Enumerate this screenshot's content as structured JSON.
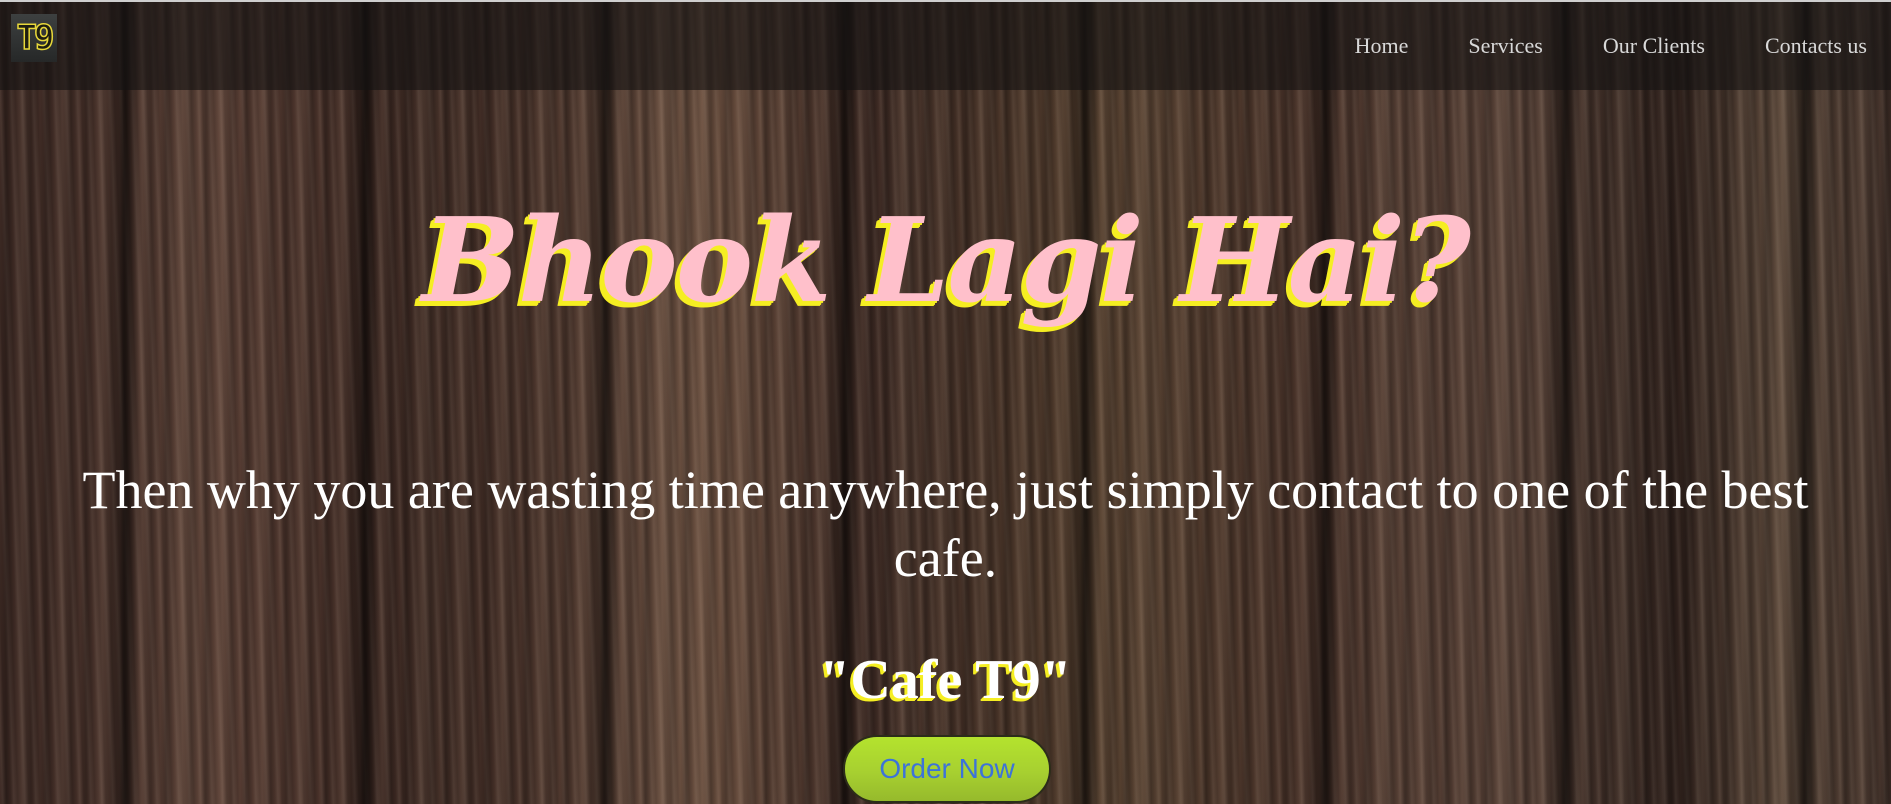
{
  "logo": {
    "text": "T9"
  },
  "nav": {
    "items": [
      {
        "label": "Home"
      },
      {
        "label": "Services"
      },
      {
        "label": "Our Clients"
      },
      {
        "label": "Contacts us"
      }
    ]
  },
  "hero": {
    "headline": "Bhook Lagi Hai?",
    "tagline": "Then why you are wasting time anywhere, just simply contact to one of the best cafe.",
    "brand": "\"Cafe T9\"",
    "cta_label": "Order Now"
  },
  "colors": {
    "headline": "#ffc0cb",
    "headline_shadow": "#f5ee22",
    "cta_background": "#a7d030",
    "cta_text": "#3d73d8",
    "navbar": "#141212"
  }
}
